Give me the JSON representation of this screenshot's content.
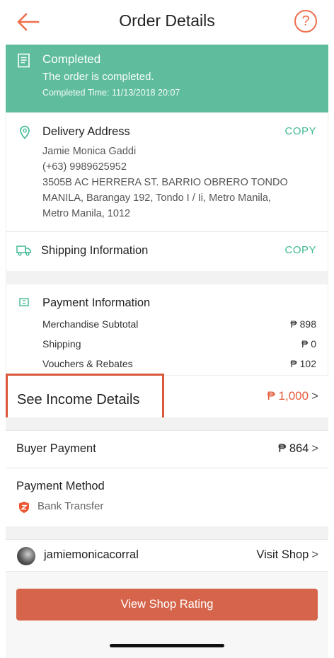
{
  "header": {
    "title": "Order Details",
    "help_label": "?"
  },
  "status": {
    "title": "Completed",
    "message": "The order is completed.",
    "time": "Completed Time: 11/13/2018 20:07",
    "color": "#5fbd9d"
  },
  "delivery": {
    "title": "Delivery Address",
    "copy_label": "COPY",
    "lines": [
      "Jamie Monica Gaddi",
      "(+63) 9989625952",
      "3505B AC HERRERA ST. BARRIO OBRERO TONDO",
      "MANILA, Barangay 192, Tondo I / Ii, Metro Manila,",
      "Metro Manila, 1012"
    ]
  },
  "shipping": {
    "title": "Shipping Information",
    "copy_label": "COPY"
  },
  "payment": {
    "title": "Payment Information",
    "rows": [
      {
        "label": "Merchandise Subtotal",
        "value": "₱ 898"
      },
      {
        "label": "Shipping",
        "value": "₱ 0"
      },
      {
        "label": "Vouchers & Rebates",
        "value": "₱ 102"
      }
    ]
  },
  "income": {
    "label": "See Income Details",
    "value": "₱ 1,000",
    "chevron": ">"
  },
  "buyer_payment": {
    "label": "Buyer Payment",
    "value": "₱ 864",
    "chevron": ">"
  },
  "payment_method": {
    "title": "Payment Method",
    "method": "Bank Transfer"
  },
  "shop": {
    "name": "jamiemonicacorral",
    "visit_label": "Visit Shop",
    "chevron": ">"
  },
  "footer": {
    "button_label": "View Shop Rating",
    "button_color": "#d5644a"
  },
  "accent": "#3fb894"
}
